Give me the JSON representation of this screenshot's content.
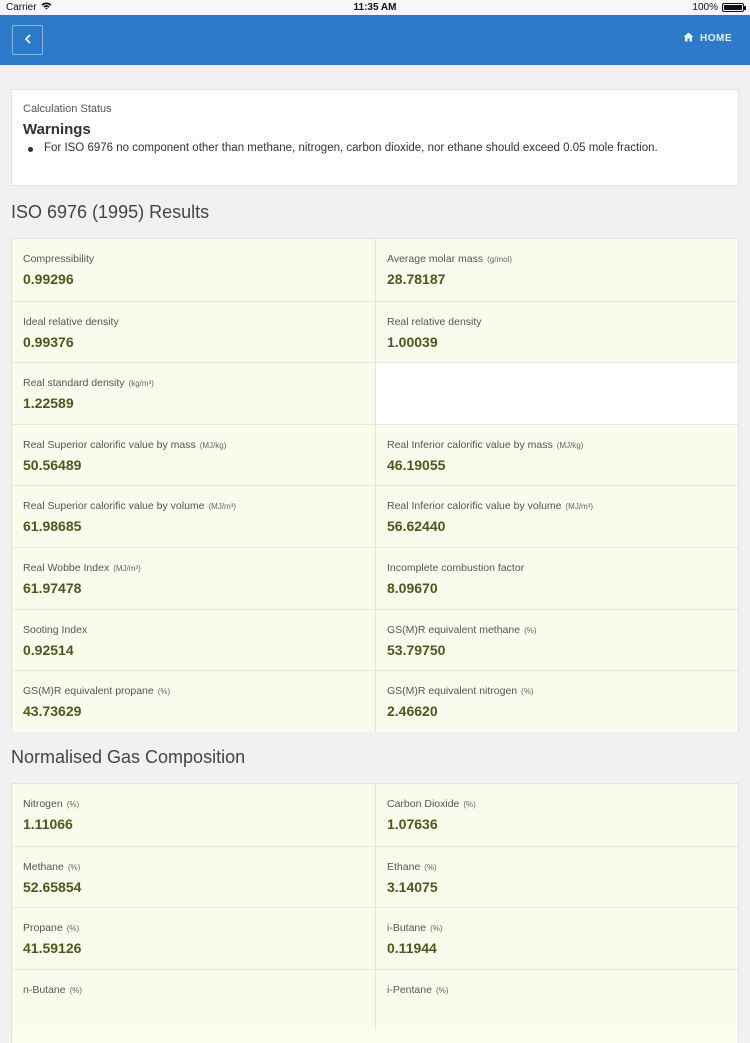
{
  "status_bar": {
    "carrier": "Carrier",
    "time": "11:35 AM",
    "battery": "100%"
  },
  "nav": {
    "home_label": "HOME"
  },
  "calc_status": {
    "label": "Calculation Status",
    "warnings_title": "Warnings",
    "warnings": [
      "For ISO 6976 no component other than methane, nitrogen, carbon dioxide, nor ethane should exceed 0.05 mole fraction."
    ]
  },
  "results": {
    "title": "ISO 6976 (1995) Results",
    "rows": [
      [
        {
          "label": "Compressibility",
          "unit": "",
          "value": "0.99296"
        },
        {
          "label": "Average molar mass",
          "unit": "(g/mol)",
          "value": "28.78187"
        }
      ],
      [
        {
          "label": "Ideal relative density",
          "unit": "",
          "value": "0.99376"
        },
        {
          "label": "Real relative density",
          "unit": "",
          "value": "1.00039"
        }
      ],
      [
        {
          "label": "Real standard density",
          "unit": "(kg/m³)",
          "value": "1.22589"
        },
        null
      ],
      [
        {
          "label": "Real Superior calorific value by mass",
          "unit": "(MJ/kg)",
          "value": "50.56489"
        },
        {
          "label": "Real Inferior calorific value by mass",
          "unit": "(MJ/kg)",
          "value": "46.19055"
        }
      ],
      [
        {
          "label": "Real Superior calorific value by volume",
          "unit": "(MJ/m³)",
          "value": "61.98685"
        },
        {
          "label": "Real Inferior calorific value by volume",
          "unit": "(MJ/m³)",
          "value": "56.62440"
        }
      ],
      [
        {
          "label": "Real Wobbe Index",
          "unit": "(MJ/m³)",
          "value": "61.97478"
        },
        {
          "label": "Incomplete combustion factor",
          "unit": "",
          "value": "8.09670"
        }
      ],
      [
        {
          "label": "Sooting Index",
          "unit": "",
          "value": "0.92514"
        },
        {
          "label": "GS(M)R equivalent methane",
          "unit": "(%)",
          "value": "53.79750"
        }
      ],
      [
        {
          "label": "GS(M)R equivalent propane",
          "unit": "(%)",
          "value": "43.73629"
        },
        {
          "label": "GS(M)R equivalent nitrogen",
          "unit": "(%)",
          "value": "2.46620"
        }
      ]
    ]
  },
  "composition": {
    "title": "Normalised Gas Composition",
    "rows": [
      [
        {
          "label": "Nitrogen",
          "unit": "(%)",
          "value": "1.11066"
        },
        {
          "label": "Carbon Dioxide",
          "unit": "(%)",
          "value": "1.07636"
        }
      ],
      [
        {
          "label": "Methane",
          "unit": "(%)",
          "value": "52.65854"
        },
        {
          "label": "Ethane",
          "unit": "(%)",
          "value": "3.14075"
        }
      ],
      [
        {
          "label": "Propane",
          "unit": "(%)",
          "value": "41.59126"
        },
        {
          "label": "i-Butane",
          "unit": "(%)",
          "value": "0.11944"
        }
      ],
      [
        {
          "label": "n-Butane",
          "unit": "(%)",
          "value": ""
        },
        {
          "label": "i-Pentane",
          "unit": "(%)",
          "value": ""
        }
      ]
    ]
  }
}
